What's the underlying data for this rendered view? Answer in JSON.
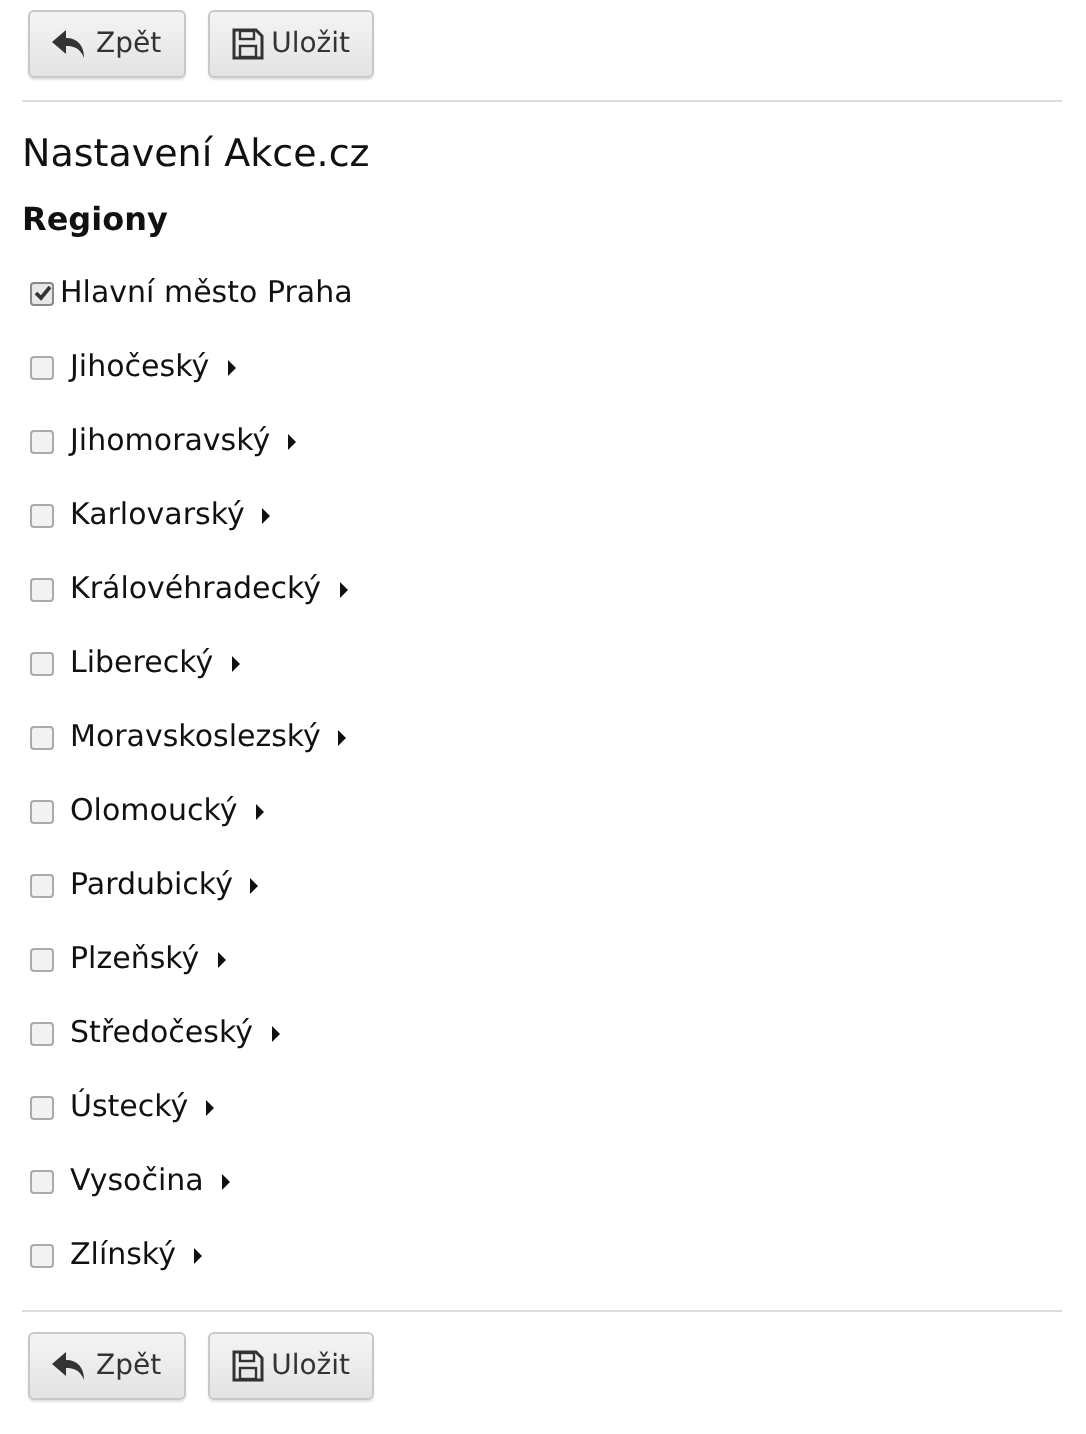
{
  "top_toolbar": {
    "buttons": [
      {
        "kind": "back",
        "label": "Zpět"
      },
      {
        "kind": "save",
        "label": "Uložit"
      }
    ]
  },
  "title": "Nastavení Akce.cz",
  "section_heading": "Regiony",
  "regions": [
    {
      "label": "Hlavní město Praha",
      "checked": true,
      "expandable": false
    },
    {
      "label": "Jihočeský",
      "checked": false,
      "expandable": true
    },
    {
      "label": "Jihomoravský",
      "checked": false,
      "expandable": true
    },
    {
      "label": "Karlovarský",
      "checked": false,
      "expandable": true
    },
    {
      "label": "Královéhradecký",
      "checked": false,
      "expandable": true
    },
    {
      "label": "Liberecký",
      "checked": false,
      "expandable": true
    },
    {
      "label": "Moravskoslezský",
      "checked": false,
      "expandable": true
    },
    {
      "label": "Olomoucký",
      "checked": false,
      "expandable": true
    },
    {
      "label": "Pardubický",
      "checked": false,
      "expandable": true
    },
    {
      "label": "Plzeňský",
      "checked": false,
      "expandable": true
    },
    {
      "label": "Středočeský",
      "checked": false,
      "expandable": true
    },
    {
      "label": "Ústecký",
      "checked": false,
      "expandable": true
    },
    {
      "label": "Vysočina",
      "checked": false,
      "expandable": true
    },
    {
      "label": "Zlínský",
      "checked": false,
      "expandable": true
    }
  ],
  "bottom_toolbar": {
    "buttons": [
      {
        "kind": "back",
        "label": "Zpět"
      },
      {
        "kind": "save",
        "label": "Uložit"
      }
    ]
  }
}
